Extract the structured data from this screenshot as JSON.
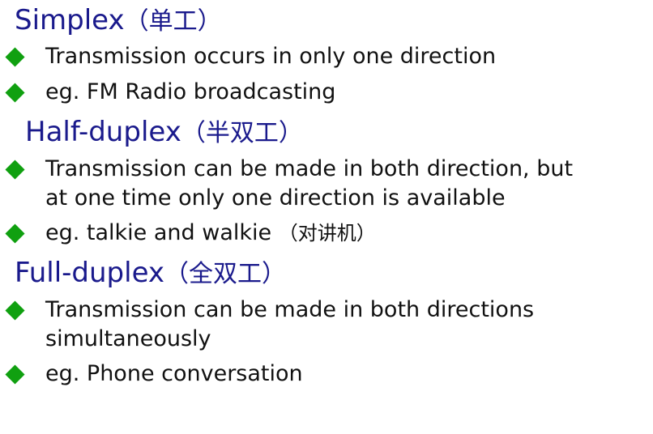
{
  "sections": [
    {
      "heading": "Simplex",
      "heading_cn": "（单工）",
      "bullets": [
        {
          "line1": "Transmission occurs in only one direction"
        },
        {
          "line1": "eg. FM Radio broadcasting"
        }
      ]
    },
    {
      "heading": "Half-duplex",
      "heading_cn": "（半双工）",
      "bullets": [
        {
          "line1": "Transmission can be made in both direction, but",
          "line2": "at one time only one direction is available"
        },
        {
          "line1": "eg. talkie and walkie ",
          "line1_cn": "（对讲机）"
        }
      ]
    },
    {
      "heading": "Full-duplex",
      "heading_cn": "（全双工）",
      "bullets": [
        {
          "line1": "Transmission can be made in both directions",
          "line2": "simultaneously"
        },
        {
          "line1": "eg. Phone conversation"
        }
      ]
    }
  ],
  "colors": {
    "heading": "#1a1a8c",
    "bullet": "#10a010",
    "text": "#111111"
  },
  "icons": {
    "bullet": "green-diamond-bullet-icon"
  }
}
